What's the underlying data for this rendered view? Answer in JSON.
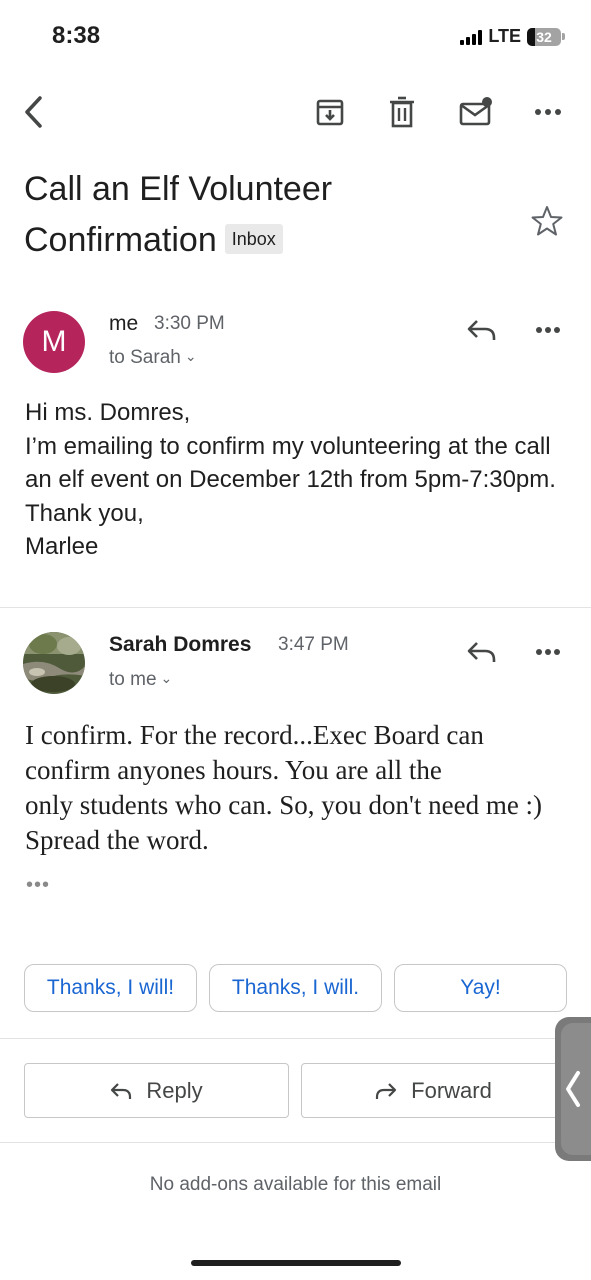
{
  "status_bar": {
    "time": "8:38",
    "network": "LTE",
    "battery": "32"
  },
  "toolbar": {
    "back_icon": "chevron-left-icon",
    "archive_icon": "archive-icon",
    "delete_icon": "trash-icon",
    "mark_unread_icon": "mail-unread-icon",
    "more_icon": "more-horizontal-icon"
  },
  "subject": {
    "title": "Call an Elf Volunteer Confirmation",
    "label": "Inbox"
  },
  "messages": [
    {
      "avatar_letter": "M",
      "avatar_color": "#b5255c",
      "sender": "me",
      "time": "3:30 PM",
      "to": "to Sarah",
      "body": "Hi ms. Domres,\nI’m emailing to confirm my volunteering at the call an elf event on December 12th from 5pm-7:30pm.\nThank you,\nMarlee"
    },
    {
      "avatar_type": "photo",
      "sender": "Sarah Domres",
      "time": "3:47 PM",
      "to": "to me",
      "body": "I confirm. For the record...Exec Board can confirm anyones hours. You are all the\nonly students who can. So, you don't need me :) Spread the word.",
      "trimmed_indicator": "•••"
    }
  ],
  "smart_replies": [
    "Thanks, I will!",
    "Thanks, I will.",
    "Yay!"
  ],
  "actions": {
    "reply": "Reply",
    "forward": "Forward"
  },
  "addons_text": "No add-ons available for this email",
  "colors": {
    "accent_blue": "#1a66d2",
    "avatar_me": "#b5255c",
    "secondary_text": "#5f6368"
  }
}
